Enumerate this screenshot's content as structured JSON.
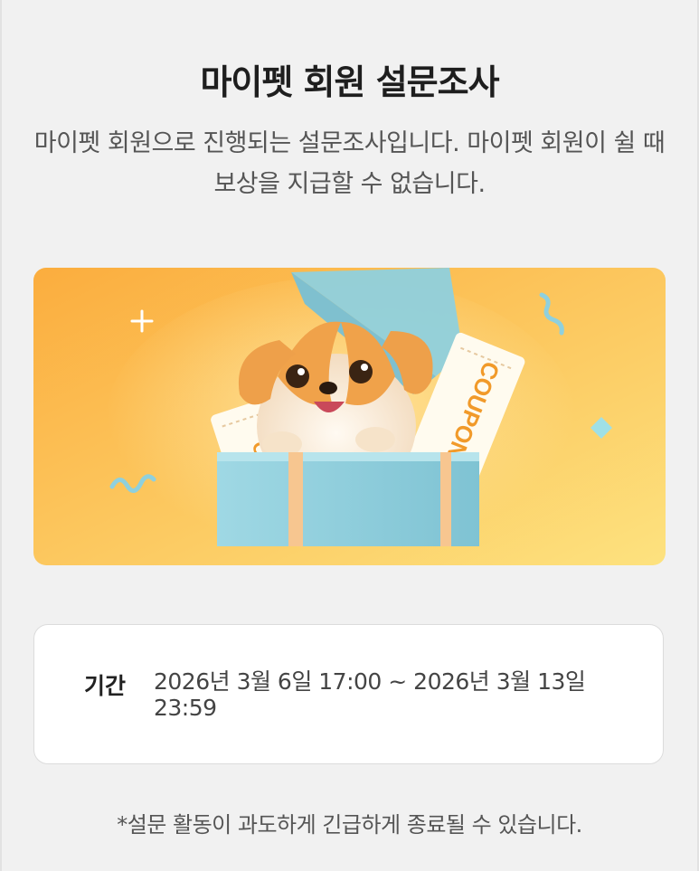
{
  "header": {
    "title": "마이펫 회원 설문조사",
    "description": "마이펫 회원으로 진행되는 설문조사입니다. 마이펫 회원이 쉴 때 보상을 지급할 수 없습니다."
  },
  "banner": {
    "coupon_text": "COUPON",
    "colors": {
      "background_start": "#fcb240",
      "background_end": "#fddc7c",
      "box": "#8fd0dd",
      "ribbon": "#f7c690"
    }
  },
  "info": {
    "period_label": "기간",
    "period_value": "2026년 3월 6일 17:00 ~ 2026년 3월 13일 23:59"
  },
  "notice": "*설문 활동이 과도하게 긴급하게 종료될 수 있습니다."
}
